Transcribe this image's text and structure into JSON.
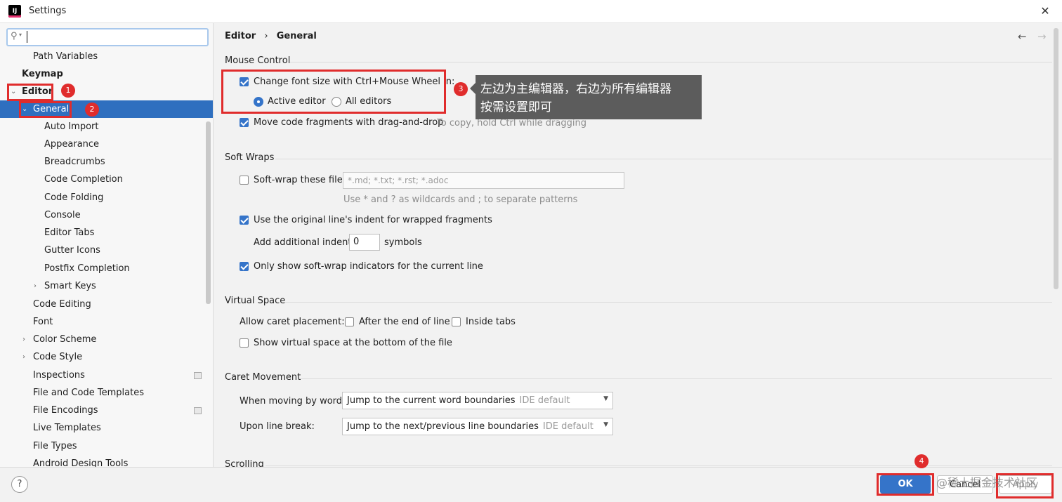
{
  "window": {
    "title": "Settings",
    "close_glyph": "✕",
    "logo_text": "IJ"
  },
  "search": {
    "value": "",
    "icon": "search-icon"
  },
  "tree": {
    "path_variables": "Path Variables",
    "keymap": "Keymap",
    "editor": "Editor",
    "general": "General",
    "auto_import": "Auto Import",
    "appearance": "Appearance",
    "breadcrumbs": "Breadcrumbs",
    "code_completion": "Code Completion",
    "code_folding": "Code Folding",
    "console": "Console",
    "editor_tabs": "Editor Tabs",
    "gutter_icons": "Gutter Icons",
    "postfix_completion": "Postfix Completion",
    "smart_keys": "Smart Keys",
    "code_editing": "Code Editing",
    "font": "Font",
    "color_scheme": "Color Scheme",
    "code_style": "Code Style",
    "inspections": "Inspections",
    "file_code_templates": "File and Code Templates",
    "file_encodings": "File Encodings",
    "live_templates": "Live Templates",
    "file_types": "File Types",
    "android_design_tools": "Android Design Tools"
  },
  "badges": {
    "b1": "1",
    "b2": "2",
    "b3": "3",
    "b4": "4"
  },
  "breadcrumb": {
    "parent": "Editor",
    "sep": "›",
    "current": "General"
  },
  "nav": {
    "back": "←",
    "forward": "→"
  },
  "mouse_control": {
    "title": "Mouse Control",
    "change_font_size": "Change font size with Ctrl+Mouse Wheel in:",
    "change_font_size_checked": true,
    "active_editor": "Active editor",
    "all_editors": "All editors",
    "selected_scope": "Active editor",
    "move_fragments": "Move code fragments with drag-and-drop",
    "move_fragments_checked": true,
    "move_hint": "To copy, hold Ctrl while dragging"
  },
  "tooltip": {
    "line1": "左边为主编辑器，右边为所有编辑器",
    "line2": "按需设置即可"
  },
  "soft_wraps": {
    "title": "Soft Wraps",
    "soft_wrap_files": "Soft-wrap these files:",
    "soft_wrap_checked": false,
    "patterns_placeholder": "*.md; *.txt; *.rst; *.adoc",
    "patterns_hint": "Use * and ? as wildcards and ; to separate patterns",
    "original_indent": "Use the original line's indent for wrapped fragments",
    "original_indent_checked": true,
    "add_indent_label": "Add additional indent:",
    "add_indent_value": "0",
    "symbols": "symbols",
    "only_show_indicators": "Only show soft-wrap indicators for the current line",
    "only_show_checked": true
  },
  "virtual_space": {
    "title": "Virtual Space",
    "allow_caret": "Allow caret placement:",
    "after_end": "After the end of line",
    "inside_tabs": "Inside tabs",
    "show_virtual": "Show virtual space at the bottom of the file"
  },
  "caret_movement": {
    "title": "Caret Movement",
    "moving_by_words": "When moving by words:",
    "moving_value": "Jump to the current word boundaries",
    "moving_default": "IDE default",
    "line_break": "Upon line break:",
    "line_break_value": "Jump to the next/previous line boundaries",
    "line_break_default": "IDE default"
  },
  "scrolling": {
    "title": "Scrolling"
  },
  "buttons": {
    "help": "?",
    "ok": "OK",
    "cancel": "Cancel",
    "apply": "Apply"
  },
  "watermark": "@稀土掘金技术社区",
  "colors": {
    "accent": "#3574c9",
    "selection": "#2f6fbf",
    "annotation": "#e02c2c",
    "tooltip": "#5c5c5c"
  }
}
